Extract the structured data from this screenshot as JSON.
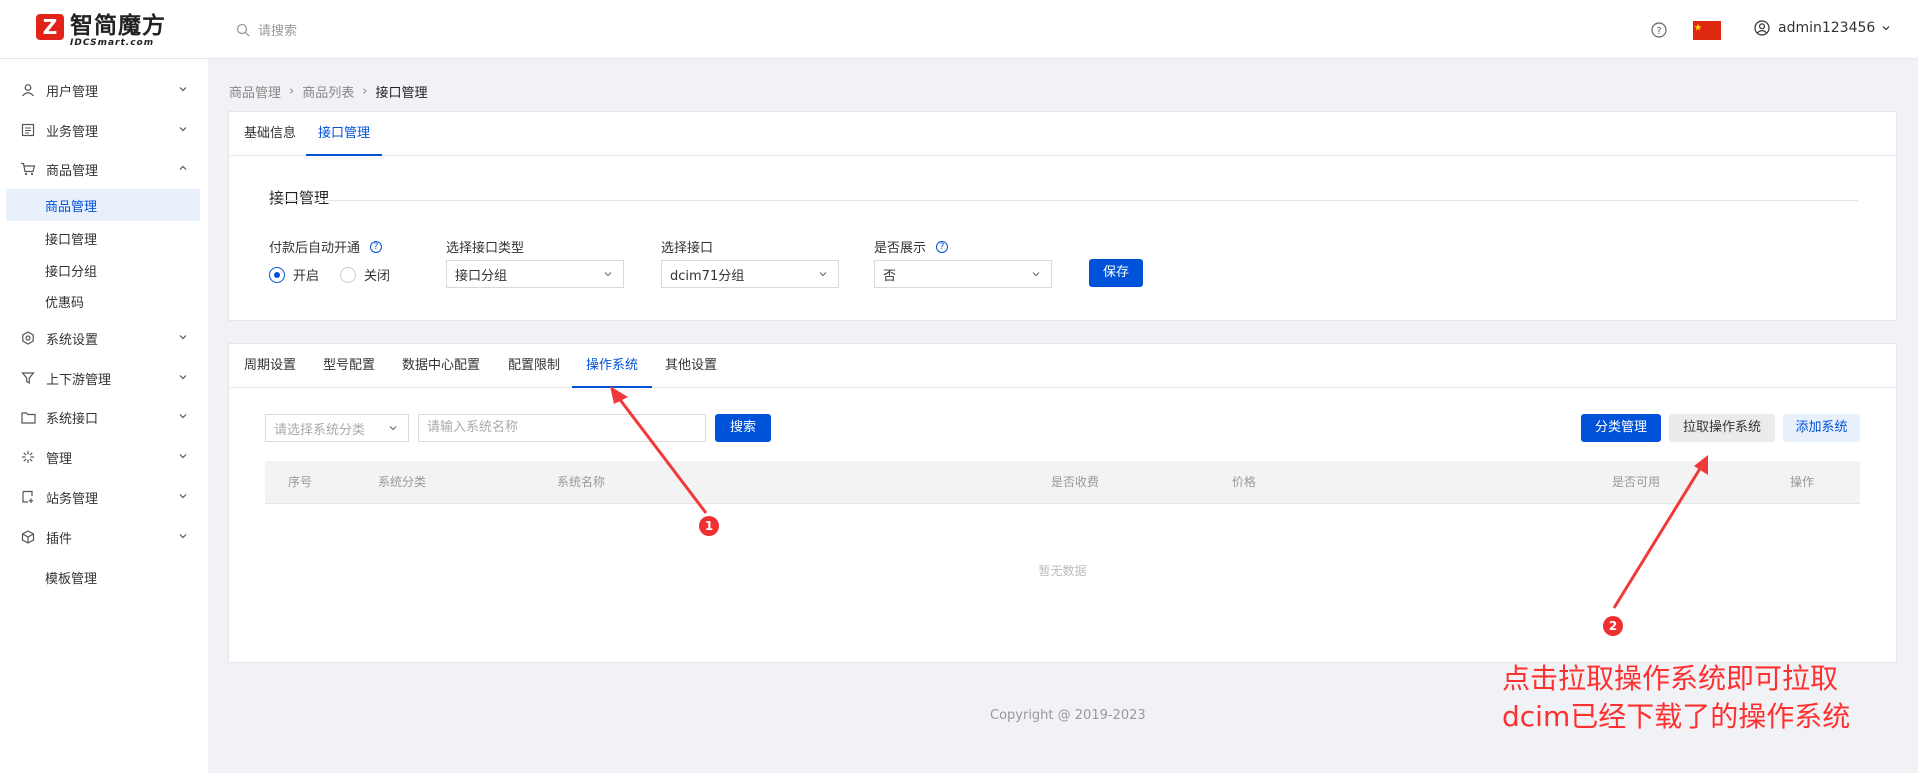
{
  "header": {
    "logo_title": "智简魔方",
    "logo_sub": "IDCSmart.com",
    "search_placeholder": "请搜索",
    "username": "admin123456"
  },
  "colors": {
    "primary": "#0052d9",
    "annotation": "#ff3030",
    "flag": "#de2910"
  },
  "sidebar": {
    "items": [
      {
        "label": "用户管理",
        "icon": "user-icon"
      },
      {
        "label": "业务管理",
        "icon": "document-icon"
      },
      {
        "label": "商品管理",
        "icon": "cart-icon"
      },
      {
        "label": "系统设置",
        "icon": "gear-icon"
      },
      {
        "label": "上下游管理",
        "icon": "filter-icon"
      },
      {
        "label": "系统接口",
        "icon": "folder-icon"
      },
      {
        "label": "管理",
        "icon": "sparkle-icon"
      },
      {
        "label": "站务管理",
        "icon": "station-icon"
      },
      {
        "label": "插件",
        "icon": "cube-icon"
      },
      {
        "label": "模板管理",
        "icon": ""
      }
    ],
    "sub_items": [
      "商品管理",
      "接口管理",
      "接口分组",
      "优惠码"
    ]
  },
  "breadcrumb": {
    "a": "商品管理",
    "b": "商品列表",
    "c": "接口管理"
  },
  "top_tabs": [
    "基础信息",
    "接口管理"
  ],
  "section": {
    "title": "接口管理",
    "auto_label": "付款后自动开通",
    "radio_on": "开启",
    "radio_off": "关闭",
    "type_label": "选择接口类型",
    "type_value": "接口分组",
    "iface_label": "选择接口",
    "iface_value": "dcim71分组",
    "show_label": "是否展示",
    "show_value": "否",
    "save": "保存"
  },
  "sub_tabs": [
    "周期设置",
    "型号配置",
    "数据中心配置",
    "配置限制",
    "操作系统",
    "其他设置"
  ],
  "os_panel": {
    "category_placeholder": "请选择系统分类",
    "name_placeholder": "请输入系统名称",
    "search": "搜索",
    "btn_category": "分类管理",
    "btn_pull": "拉取操作系统",
    "btn_add": "添加系统",
    "columns": [
      "序号",
      "系统分类",
      "系统名称",
      "是否收费",
      "价格",
      "是否可用",
      "操作"
    ],
    "empty": "暂无数据"
  },
  "footer": {
    "copyright": "Copyright @ 2019-2023"
  },
  "annotation": {
    "line1": "点击拉取操作系统即可拉取",
    "line2": "dcim已经下载了的操作系统",
    "badge1": "1",
    "badge2": "2"
  }
}
